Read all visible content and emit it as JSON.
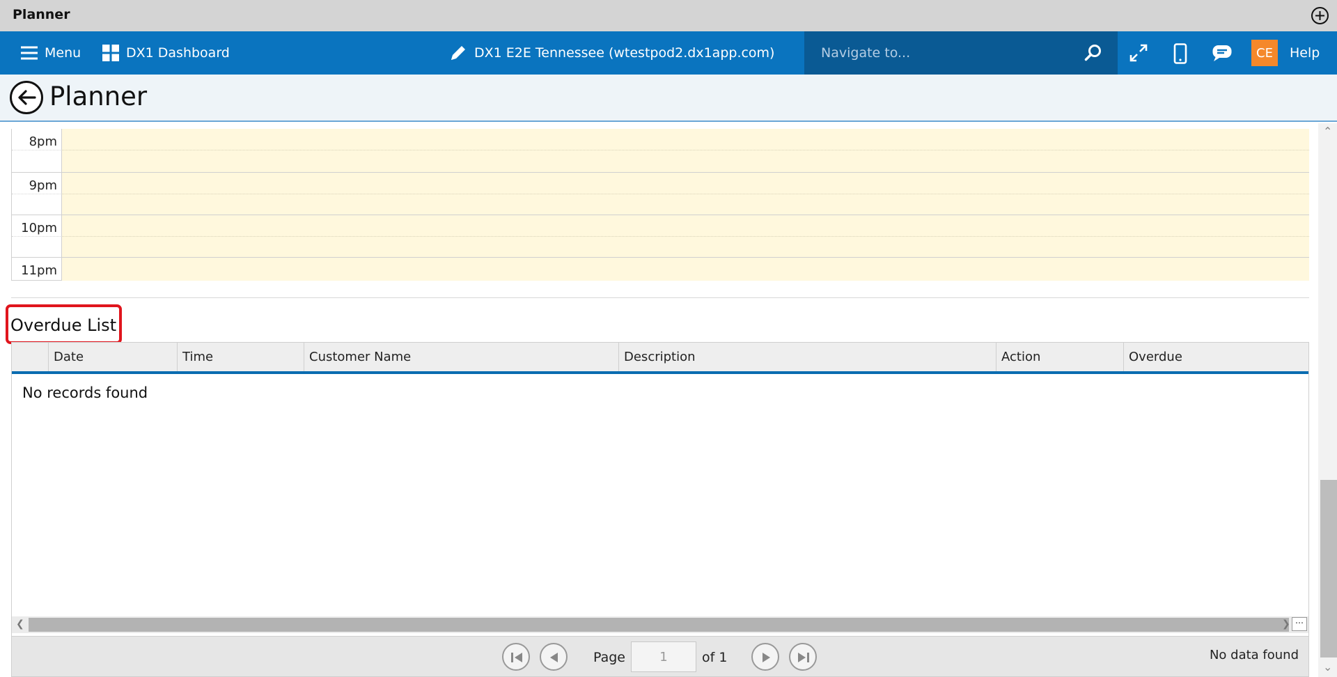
{
  "window": {
    "title": "Planner"
  },
  "nav": {
    "menu_label": "Menu",
    "dashboard_label": "DX1 Dashboard",
    "site_label": "DX1 E2E Tennessee (wtestpod2.dx1app.com)",
    "search_placeholder": "Navigate to...",
    "avatar_initials": "CE",
    "help_label": "Help"
  },
  "page": {
    "title": "Planner"
  },
  "calendar": {
    "hours": [
      "8pm",
      "9pm",
      "10pm",
      "11pm"
    ]
  },
  "overdue": {
    "title": "Overdue List",
    "columns": [
      "Date",
      "Time",
      "Customer Name",
      "Description",
      "Action",
      "Overdue"
    ],
    "empty_message": "No records found"
  },
  "pager": {
    "page_label": "Page",
    "current_page": "1",
    "of_label": "of 1",
    "status": "No data found"
  },
  "colors": {
    "nav_blue": "#0a74bf",
    "search_bg": "#0a5a94",
    "avatar": "#f5882b",
    "highlight": "#e0151d",
    "calendar_slot": "#fff8dd"
  }
}
